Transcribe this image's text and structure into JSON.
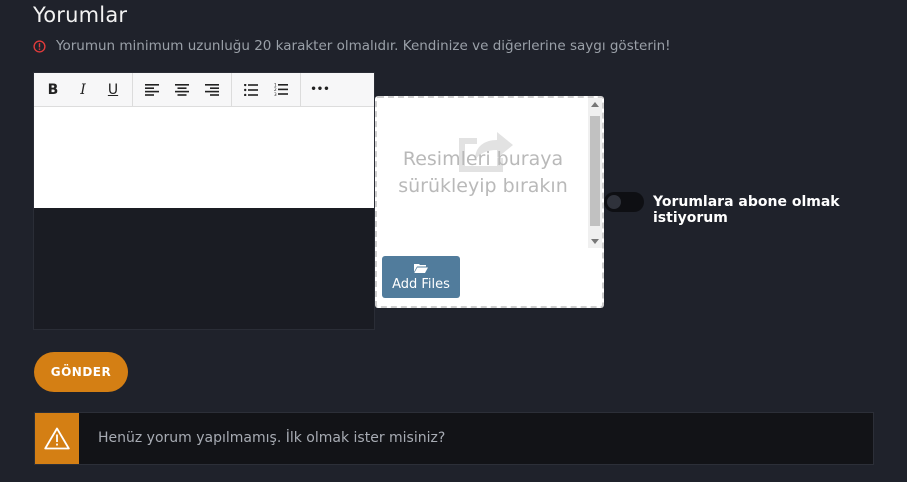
{
  "section": {
    "title": "Yorumlar",
    "notice": "Yorumun minimum uzunluğu 20 karakter olmalıdır. Kendinize ve diğerlerine saygı gösterin!"
  },
  "toolbar": {
    "bold": "B",
    "italic": "I",
    "underline": "U",
    "more": "•••"
  },
  "dropzone": {
    "hint": "Resimleri buraya sürükleyip bırakın",
    "add_files_label": "Add Files"
  },
  "subscribe": {
    "label": "Yorumlara abone olmak istiyorum",
    "checked": false
  },
  "submit": {
    "label": "GÖNDER"
  },
  "empty_alert": {
    "text": "Henüz yorum yapılmamış. İlk olmak ister misiniz?"
  },
  "colors": {
    "background": "#1f222b",
    "accent": "#d47f14",
    "add_files_button": "#517c9c",
    "notice_icon": "#e03b3b"
  }
}
